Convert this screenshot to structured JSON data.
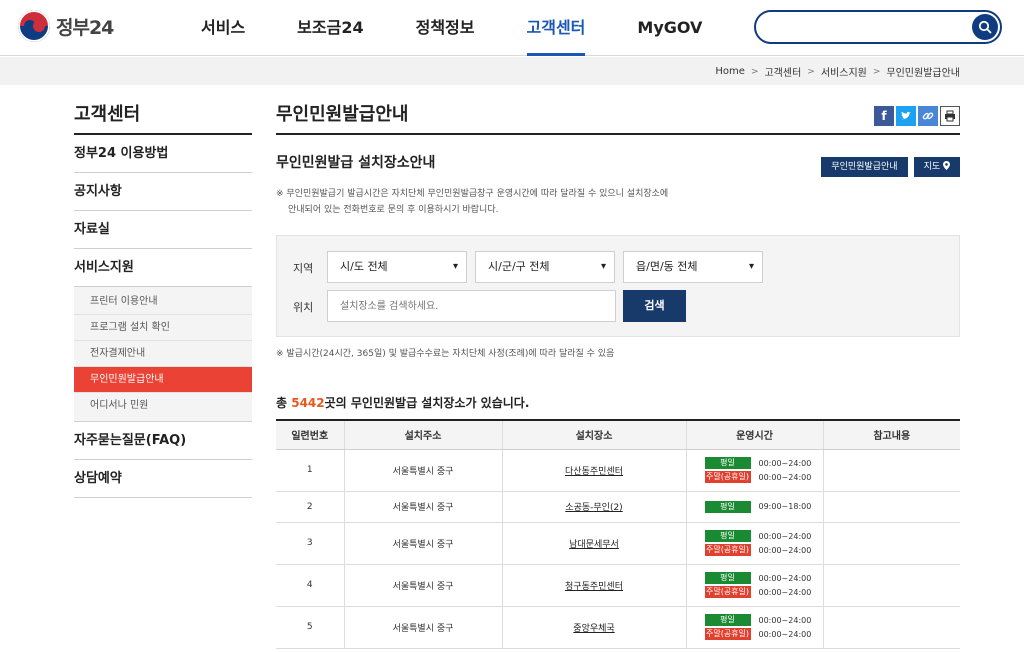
{
  "header": {
    "logo_text": "정부24",
    "nav": [
      "서비스",
      "보조금24",
      "정책정보",
      "고객센터",
      "MyGOV"
    ],
    "active_nav": "고객센터",
    "search_value": ""
  },
  "breadcrumb": [
    "Home",
    "고객센터",
    "서비스지원",
    "무인민원발급안내"
  ],
  "sidebar": {
    "title": "고객센터",
    "items": [
      {
        "label": "정부24 이용방법"
      },
      {
        "label": "공지사항"
      },
      {
        "label": "자료실"
      },
      {
        "label": "서비스지원"
      },
      {
        "label": "자주묻는질문(FAQ)"
      },
      {
        "label": "상담예약"
      }
    ],
    "subitems": [
      {
        "label": "프린터 이용안내"
      },
      {
        "label": "프로그램 설치 확인"
      },
      {
        "label": "전자결제안내"
      },
      {
        "label": "무인민원발급안내"
      },
      {
        "label": "어디서나 민원"
      }
    ]
  },
  "main": {
    "page_title": "무인민원발급안내",
    "section_title": "무인민원발급 설치장소안내",
    "btn_info": "무인민원발급안내",
    "btn_map": "지도",
    "notice1_line1": "※ 무인민원발급기 발급시간은 자치단체 무인민원발급창구 운영시간에 따라 달라질 수 있으니 설치장소에",
    "notice1_line2": "안내되어 있는 전화번호로 문의 후 이용하시기 바랍니다.",
    "filter": {
      "region_label": "지역",
      "sido": "시/도 전체",
      "sigungu": "시/군/구 전체",
      "eupmyeondong": "읍/면/동 전체",
      "location_label": "위치",
      "location_placeholder": "설치장소를 검색하세요.",
      "search_button": "검색"
    },
    "notice2": "※ 발급시간(24시간, 365일) 및 발급수수료는 자치단체 사정(조례)에 따라 달라질 수 있음",
    "total_prefix": "총 ",
    "total_count": "5442",
    "total_suffix": "곳의 무인민원발급 설치장소가 있습니다."
  },
  "table": {
    "columns": [
      "일련번호",
      "설치주소",
      "설치장소",
      "운영시간",
      "참고내용"
    ],
    "weekday_tag": "평일",
    "weekend_tag": "주말(공휴일)",
    "rows": [
      {
        "no": "1",
        "address": "서울특별시 중구",
        "place": "다산동주민센터",
        "weekday": "00:00~24:00",
        "weekend": "00:00~24:00",
        "note": ""
      },
      {
        "no": "2",
        "address": "서울특별시 중구",
        "place": "소공동-무인(2)",
        "weekday": "09:00~18:00",
        "weekend": "",
        "note": ""
      },
      {
        "no": "3",
        "address": "서울특별시 중구",
        "place": "남대문세무서",
        "weekday": "00:00~24:00",
        "weekend": "00:00~24:00",
        "note": ""
      },
      {
        "no": "4",
        "address": "서울특별시 중구",
        "place": "청구동주민센터",
        "weekday": "00:00~24:00",
        "weekend": "00:00~24:00",
        "note": ""
      },
      {
        "no": "5",
        "address": "서울특별시 중구",
        "place": "중앙우체국",
        "weekday": "00:00~24:00",
        "weekend": "00:00~24:00",
        "note": ""
      }
    ]
  },
  "colors": {
    "navy": "#183a6b",
    "accent_blue": "#1a57b5",
    "active_red": "#ea4335",
    "weekday_green": "#1a8a33",
    "weekend_red": "#e0402e",
    "count_orange": "#e8581c"
  }
}
